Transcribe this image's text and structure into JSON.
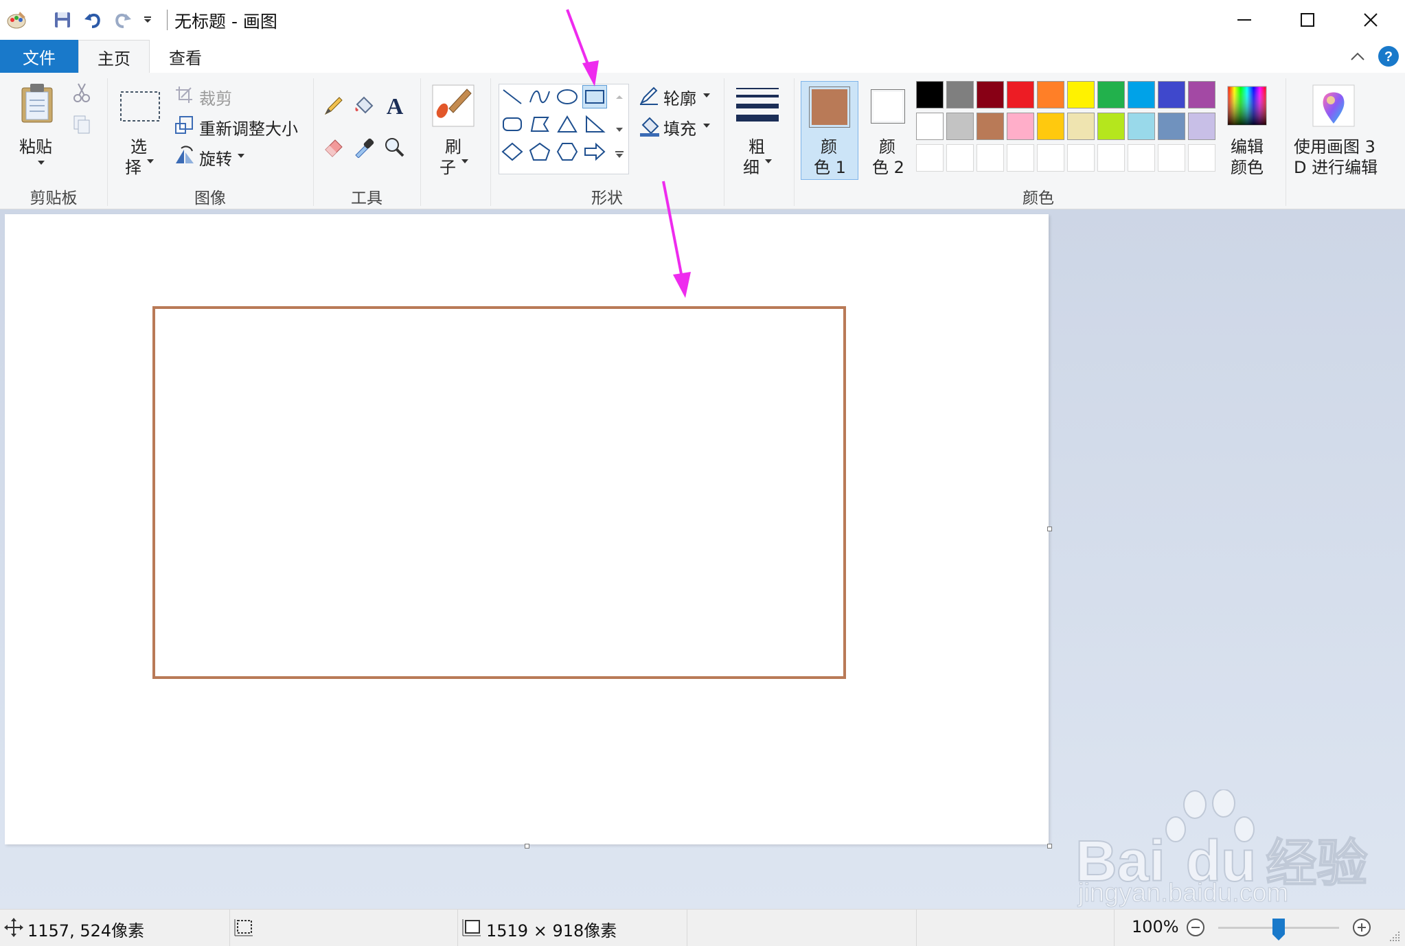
{
  "window": {
    "title": "无标题 - 画图",
    "minimize_glyph": "─",
    "maximize_glyph": "☐",
    "close_glyph": "✕"
  },
  "quick_access": {
    "icons": [
      "paint-app-icon",
      "save-icon",
      "undo-icon",
      "redo-icon",
      "customize-dropdown-icon"
    ]
  },
  "tabs": [
    {
      "label": "文件",
      "active": false
    },
    {
      "label": "主页",
      "active": true
    },
    {
      "label": "查看",
      "active": false
    }
  ],
  "ribbon": {
    "clipboard": {
      "group": "剪贴板",
      "paste": "粘贴"
    },
    "image": {
      "group": "图像",
      "select_line1": "选",
      "select_line2": "择",
      "crop": "裁剪",
      "resize": "重新调整大小",
      "rotate": "旋转"
    },
    "tools": {
      "group": "工具"
    },
    "brushes": {
      "line1": "刷",
      "line2": "子"
    },
    "shapes": {
      "group": "形状",
      "outline": "轮廓",
      "fill": "填充"
    },
    "size": {
      "line1": "粗",
      "line2": "细"
    },
    "colors": {
      "group": "颜色",
      "color1_line1": "颜",
      "color1_line2": "色 1",
      "color2_line1": "颜",
      "color2_line2": "色 2",
      "color1_value": "#b97a57",
      "color2_value": "#ffffff",
      "edit_line1": "编辑",
      "edit_line2": "颜色",
      "paint3d_line1": "使用画图 3",
      "paint3d_line2": "D 进行编辑",
      "palette_row1": [
        "#000000",
        "#7f7f7f",
        "#880015",
        "#ed1c24",
        "#ff7f27",
        "#fff200",
        "#22b14c",
        "#00a2e8",
        "#3f48cc",
        "#a349a4"
      ],
      "palette_row2": [
        "#ffffff",
        "#c3c3c3",
        "#b97a57",
        "#ffaec9",
        "#ffc90e",
        "#efe4b0",
        "#b5e61d",
        "#99d9ea",
        "#7092be",
        "#c8bfe7"
      ]
    }
  },
  "canvas": {
    "shape_outline_color": "#b97a57"
  },
  "annotations": {
    "arrow_color": "#ee2bee"
  },
  "status": {
    "cursor_pos": "1157, 524像素",
    "image_size": "1519 × 918像素",
    "zoom": "100%",
    "zoom_level": 0.5
  },
  "watermark": {
    "brand": "Bai",
    "brand2": "du",
    "cn": "经验",
    "url": "jingyan.baidu.com"
  }
}
